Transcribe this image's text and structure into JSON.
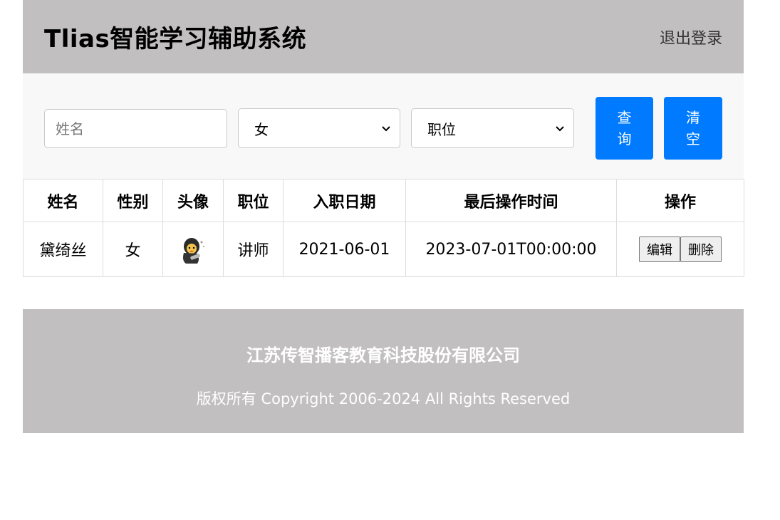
{
  "header": {
    "title": "Tlias智能学习辅助系统",
    "logout_label": "退出登录"
  },
  "search": {
    "name_placeholder": "姓名",
    "gender_selected": "女",
    "job_placeholder": "职位",
    "query_label": "查询",
    "clear_label": "清空"
  },
  "table": {
    "headers": [
      "姓名",
      "性别",
      "头像",
      "职位",
      "入职日期",
      "最后操作时间",
      "操作"
    ],
    "rows": [
      {
        "name": "黛绮丝",
        "gender": "女",
        "avatar_icon": "avatar-icon",
        "job": "讲师",
        "entry_date": "2021-06-01",
        "update_time": "2023-07-01T00:00:00",
        "edit_label": "编辑",
        "delete_label": "删除"
      }
    ]
  },
  "footer": {
    "company": "江苏传智播客教育科技股份有限公司",
    "copyright": "版权所有 Copyright 2006-2024 All Rights Reserved"
  },
  "colors": {
    "header_bg": "#c1bfc0",
    "primary": "#007bff",
    "search_bg": "#f8f8f8"
  }
}
